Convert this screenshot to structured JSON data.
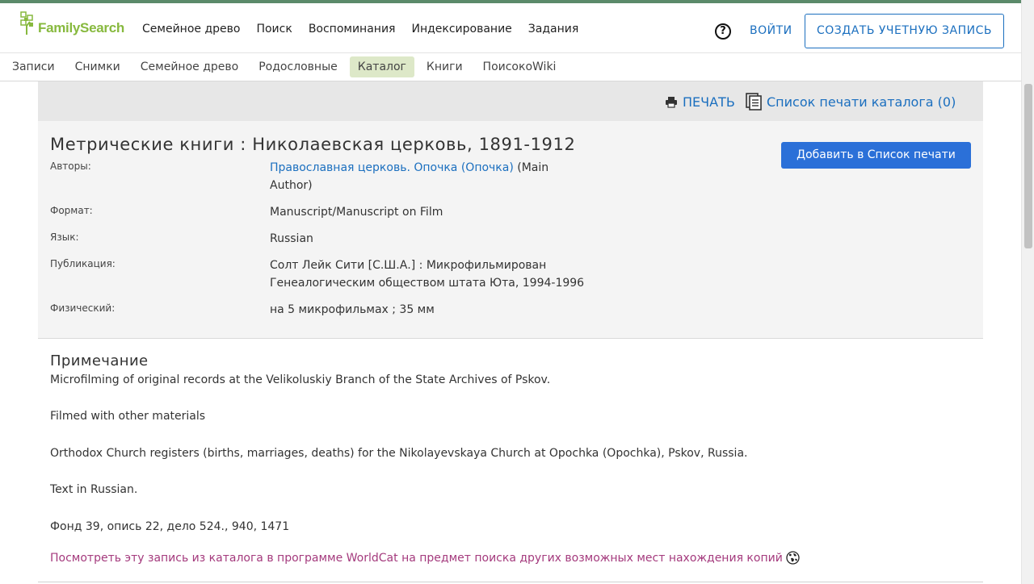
{
  "header": {
    "logo_text": "FamilySearch",
    "main_nav": [
      "Семейное древо",
      "Поиск",
      "Воспоминания",
      "Индексирование",
      "Задания"
    ],
    "help_label": "?",
    "login_label": "ВОЙТИ",
    "signup_label": "СОЗДАТЬ УЧЕТНУЮ ЗАПИСЬ"
  },
  "subnav": {
    "items": [
      "Записи",
      "Снимки",
      "Семейное древо",
      "Родословные",
      "Каталог",
      "Книги",
      "ПоисокоWiki"
    ],
    "active": "Каталог"
  },
  "printbar": {
    "print_label": "ПЕЧАТЬ",
    "print_list_label": "Список печати каталога (0)"
  },
  "record": {
    "title": "Метрические книги : Николаевская церковь, 1891-1912",
    "add_button": "Добавить в Список печати",
    "authors_label": "Авторы:",
    "authors_link": "Православная церковь. Опочка (Опочка)",
    "authors_role_1": " (Main",
    "authors_role_2": "Author)",
    "format_label": "Формат:",
    "format_value": "Manuscript/Manuscript on Film",
    "language_label": "Язык:",
    "language_value": "Russian",
    "publication_label": "Публикация:",
    "publication_line1": "Солт Лейк Сити [С.Ш.А.] : Микрофильмирован",
    "publication_line2": "Генеалогическим обществом штата Юта, 1994-1996",
    "physical_label": "Физический:",
    "physical_value": "на 5 микрофильмах ; 35 мм"
  },
  "notes": {
    "heading": "Примечание",
    "lines": [
      "Microfilming of original records at the Velikoluskiy Branch of the State Archives of Pskov.",
      "Filmed with other materials",
      "Orthodox Church registers (births, marriages, deaths) for the Nikolayevskaya Church at Opochka (Opochka), Pskov, Russia.",
      "Text in Russian.",
      "Фонд 39, опись 22, дело 524., 940, 1471"
    ],
    "worldcat_link": "Посмотреть эту запись из каталога в программе WorldCat на предмет поиска других возможных мест нахождения копий"
  },
  "colors": {
    "accent": "#5b8a6a",
    "brand_green": "#87b93e",
    "link_blue": "#1b6fbf",
    "button_blue": "#2b70d8",
    "worldcat_purple": "#a43a7d",
    "active_tab": "#dde8c8"
  }
}
